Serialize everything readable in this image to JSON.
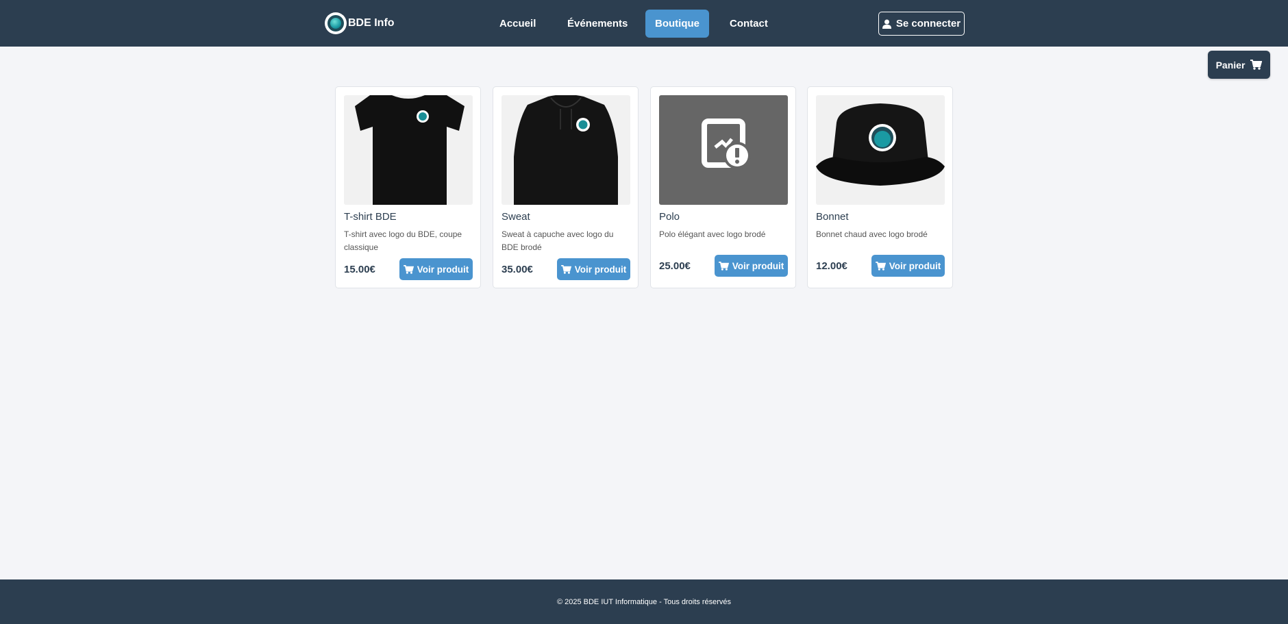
{
  "header": {
    "brand": "BDE Info",
    "nav": [
      {
        "label": "Accueil"
      },
      {
        "label": "Événements"
      },
      {
        "label": "Boutique"
      },
      {
        "label": "Contact"
      }
    ],
    "login_label": "Se connecter"
  },
  "cart": {
    "label": "Panier"
  },
  "products": [
    {
      "name": "T-shirt BDE",
      "description": "T-shirt avec logo du BDE, coupe classique",
      "price": "15.00€",
      "button": "Voir produit",
      "image": "tshirt-image"
    },
    {
      "name": "Sweat",
      "description": "Sweat à capuche avec logo du BDE brodé",
      "price": "35.00€",
      "button": "Voir produit",
      "image": "hoodie-image"
    },
    {
      "name": "Polo",
      "description": "Polo élégant avec logo brodé",
      "price": "25.00€",
      "button": "Voir produit",
      "image": "broken-image-icon"
    },
    {
      "name": "Bonnet",
      "description": "Bonnet chaud avec logo brodé",
      "price": "12.00€",
      "button": "Voir produit",
      "image": "bucket-hat-image"
    }
  ],
  "footer": {
    "text": "© 2025 BDE IUT Informatique - Tous droits réservés"
  },
  "colors": {
    "navbar": "#2c3e50",
    "accent": "#4a94cf",
    "background": "#f4f5f8"
  }
}
